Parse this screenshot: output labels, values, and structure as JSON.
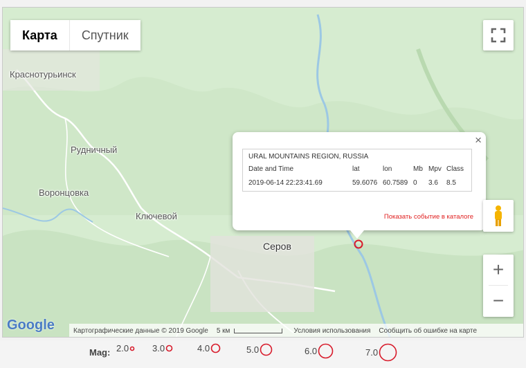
{
  "map": {
    "tabs": [
      {
        "label": "Карта"
      },
      {
        "label": "Спутник"
      }
    ],
    "places": {
      "krasnoturinsk": "Краснотурьинск",
      "rudnichny": "Рудничный",
      "vorontsovka": "Воронцовка",
      "klyuchevoy": "Ключевой",
      "serov": "Серов"
    },
    "zoom_in": "+",
    "zoom_out": "−",
    "logo": "Google",
    "attribution": {
      "data": "Картографические данные © 2019 Google",
      "scale": "5 км",
      "terms": "Условия использования",
      "report": "Сообщить об ошибке на карте"
    }
  },
  "popup": {
    "region": "URAL MOUNTAINS REGION, RUSSIA",
    "headers": {
      "datetime": "Date and Time",
      "lat": "lat",
      "lon": "lon",
      "mb": "Mb",
      "mpv": "Mpv",
      "class": "Class"
    },
    "row": {
      "datetime": "2019-06-14 22:23:41.69",
      "lat": "59.6076",
      "lon": "60.7589",
      "mb": "0",
      "mpv": "3.6",
      "class": "8.5"
    },
    "link": "Показать событие в каталоге",
    "close": "×"
  },
  "legend": {
    "label": "Mag:",
    "items": [
      {
        "label": "2.0",
        "size": 2.0
      },
      {
        "label": "3.0",
        "size": 3.0
      },
      {
        "label": "4.0",
        "size": 4.0
      },
      {
        "label": "5.0",
        "size": 5.0
      },
      {
        "label": "6.0",
        "size": 6.0
      },
      {
        "label": "7.0",
        "size": 7.0
      }
    ]
  },
  "colors": {
    "marker": "#d81b2b",
    "link": "#e02020"
  }
}
